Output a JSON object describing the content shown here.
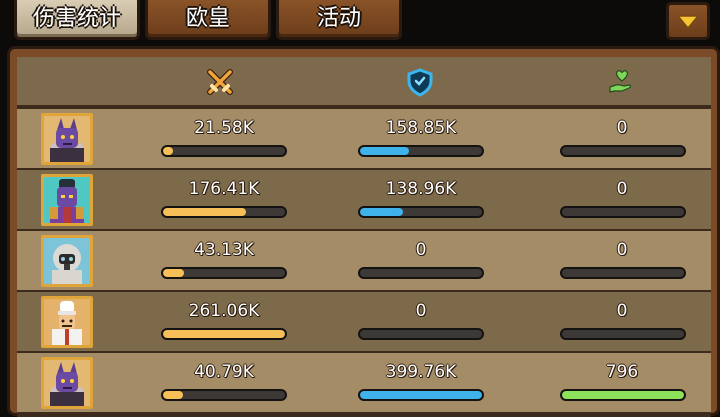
{
  "tabs": [
    {
      "label": "伤害统计",
      "active": true
    },
    {
      "label": "欧皇",
      "active": false
    },
    {
      "label": "活动",
      "active": false
    }
  ],
  "collapse_button_icon": "chevron-down-icon",
  "columns": [
    {
      "icon": "crossed-swords-icon",
      "meaning": "damage",
      "color": "#f2a33a"
    },
    {
      "icon": "shield-icon",
      "meaning": "damage-taken",
      "color": "#3bb6ee"
    },
    {
      "icon": "heart-hand-icon",
      "meaning": "healing",
      "color": "#7cd65a"
    }
  ],
  "rows": [
    {
      "avatar": "purple-spiked-demon-portrait",
      "damage": "21.58K",
      "damage_fill": 0.08,
      "tank": "158.85K",
      "tank_fill": 0.4,
      "heal": "0",
      "heal_fill": 0
    },
    {
      "avatar": "purple-mohawk-warrior-portrait",
      "damage": "176.41K",
      "damage_fill": 0.68,
      "tank": "138.96K",
      "tank_fill": 0.35,
      "heal": "0",
      "heal_fill": 0
    },
    {
      "avatar": "white-hooded-masked-portrait",
      "damage": "43.13K",
      "damage_fill": 0.17,
      "tank": "0",
      "tank_fill": 0,
      "heal": "0",
      "heal_fill": 0
    },
    {
      "avatar": "chef-hat-cook-portrait",
      "damage": "261.06K",
      "damage_fill": 1.0,
      "tank": "0",
      "tank_fill": 0,
      "heal": "0",
      "heal_fill": 0
    },
    {
      "avatar": "purple-spiked-demon-portrait",
      "damage": "40.79K",
      "damage_fill": 0.16,
      "tank": "399.76K",
      "tank_fill": 1.0,
      "heal": "796",
      "heal_fill": 1.0
    }
  ]
}
